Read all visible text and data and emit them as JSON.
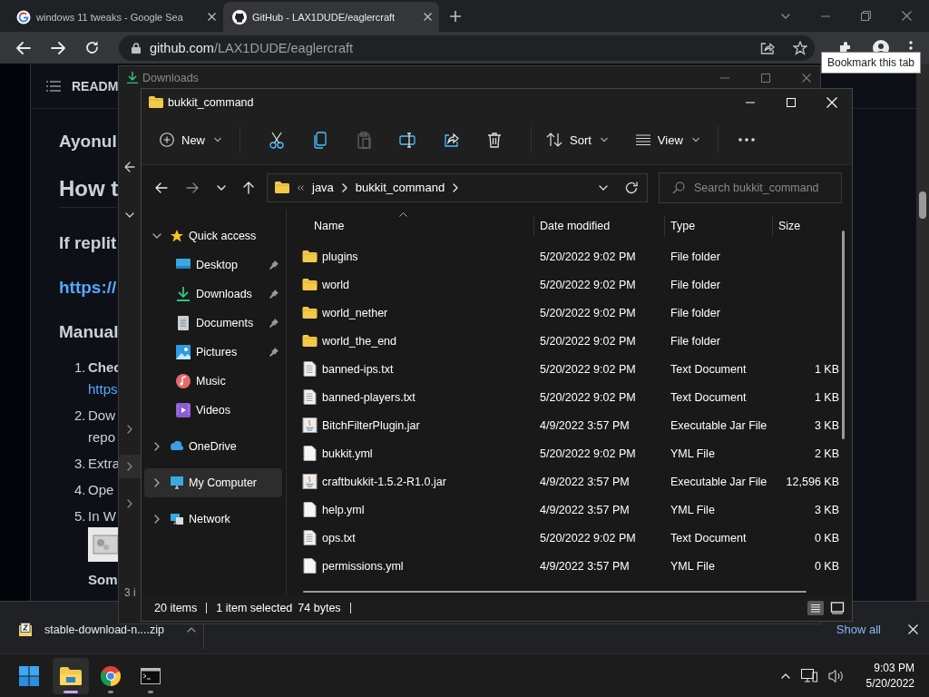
{
  "browser": {
    "tabs": [
      {
        "title": "windows 11 tweaks - Google Sea",
        "selected": false
      },
      {
        "title": "GitHub - LAX1DUDE/eaglercraft",
        "selected": true
      }
    ],
    "address": {
      "host": "github.com",
      "path": "/LAX1DUDE/eaglercraft"
    },
    "tooltip": "Bookmark this tab"
  },
  "readme": {
    "header": "READM",
    "blocks": [
      {
        "kind": "title",
        "text": "Ayonul"
      },
      {
        "kind": "heading",
        "text": "How t"
      },
      {
        "kind": "subheading",
        "text": "If replit"
      },
      {
        "kind": "link",
        "text": "https://"
      },
      {
        "kind": "subheading",
        "text": "Manual"
      },
      {
        "kind": "item",
        "number": "1.",
        "text": "**Chec**"
      },
      {
        "kind": "link_line",
        "text": "https"
      },
      {
        "kind": "item",
        "number": "2.",
        "text": "Dow"
      },
      {
        "kind": "line",
        "text": "repo"
      },
      {
        "kind": "item",
        "number": "3.",
        "text": "Extra"
      },
      {
        "kind": "item",
        "number": "4.",
        "text": "Ope"
      },
      {
        "kind": "item",
        "number": "5.",
        "text": "In W"
      },
      {
        "kind": "picture"
      },
      {
        "kind": "bold_line",
        "text": "Som"
      }
    ]
  },
  "downloads_window": {
    "title": "Downloads",
    "status": "3 i"
  },
  "explorer": {
    "title": "bukkit_command",
    "toolbar": {
      "new": "New",
      "sort": "Sort",
      "view": "View",
      "paste_disabled": true
    },
    "breadcrumb": [
      "java",
      "bukkit_command"
    ],
    "search_placeholder": "Search bukkit_command",
    "nav": [
      {
        "label": "Quick access",
        "expanded": true,
        "selected": false,
        "children": [
          {
            "label": "Desktop",
            "pinned": true,
            "selected": false
          },
          {
            "label": "Downloads",
            "pinned": true,
            "selected": false
          },
          {
            "label": "Documents",
            "pinned": true,
            "selected": false
          },
          {
            "label": "Pictures",
            "pinned": true,
            "selected": false
          },
          {
            "label": "Music",
            "pinned": false,
            "selected": false
          },
          {
            "label": "Videos",
            "pinned": false,
            "selected": false
          }
        ]
      },
      {
        "label": "OneDrive",
        "expanded": false,
        "selected": false
      },
      {
        "label": "My Computer",
        "expanded": false,
        "selected": true
      },
      {
        "label": "Network",
        "expanded": false,
        "selected": false
      }
    ],
    "columns": [
      "Name",
      "Date modified",
      "Type",
      "Size"
    ],
    "files": [
      {
        "kind": "folder",
        "name": "plugins",
        "date": "5/20/2022 9:02 PM",
        "type": "File folder"
      },
      {
        "kind": "folder",
        "name": "world",
        "date": "5/20/2022 9:02 PM",
        "type": "File folder"
      },
      {
        "kind": "folder",
        "name": "world_nether",
        "date": "5/20/2022 9:02 PM",
        "type": "File folder"
      },
      {
        "kind": "folder",
        "name": "world_the_end",
        "date": "5/20/2022 9:02 PM",
        "type": "File folder"
      },
      {
        "kind": "text",
        "name": "banned-ips.txt",
        "date": "5/20/2022 9:02 PM",
        "type": "Text Document",
        "size": "1 KB"
      },
      {
        "kind": "text",
        "name": "banned-players.txt",
        "date": "5/20/2022 9:02 PM",
        "type": "Text Document",
        "size": "1 KB"
      },
      {
        "kind": "jar",
        "name": "BitchFilterPlugin.jar",
        "date": "4/9/2022 3:57 PM",
        "type": "Executable Jar File",
        "size": "3 KB"
      },
      {
        "kind": "yml",
        "name": "bukkit.yml",
        "date": "5/20/2022 9:02 PM",
        "type": "YML File",
        "size": "2 KB"
      },
      {
        "kind": "jar",
        "name": "craftbukkit-1.5.2-R1.0.jar",
        "date": "4/9/2022 3:57 PM",
        "type": "Executable Jar File",
        "size": "12,596 KB"
      },
      {
        "kind": "yml",
        "name": "help.yml",
        "date": "4/9/2022 3:57 PM",
        "type": "YML File",
        "size": "3 KB"
      },
      {
        "kind": "text",
        "name": "ops.txt",
        "date": "5/20/2022 9:02 PM",
        "type": "Text Document",
        "size": "0 KB"
      },
      {
        "kind": "yml",
        "name": "permissions.yml",
        "date": "4/9/2022 3:57 PM",
        "type": "YML File",
        "size": "0 KB"
      }
    ],
    "status": {
      "items": "20 items",
      "selection": "1 item selected",
      "size": "74 bytes"
    }
  },
  "download_bar": {
    "file": "stable-download-n....zip",
    "show_all": "Show all"
  },
  "taskbar": {
    "apps": [
      {
        "active": true
      },
      {
        "active": false
      },
      {
        "active": false
      }
    ],
    "time": "9:03 PM",
    "date": "5/20/2022"
  }
}
